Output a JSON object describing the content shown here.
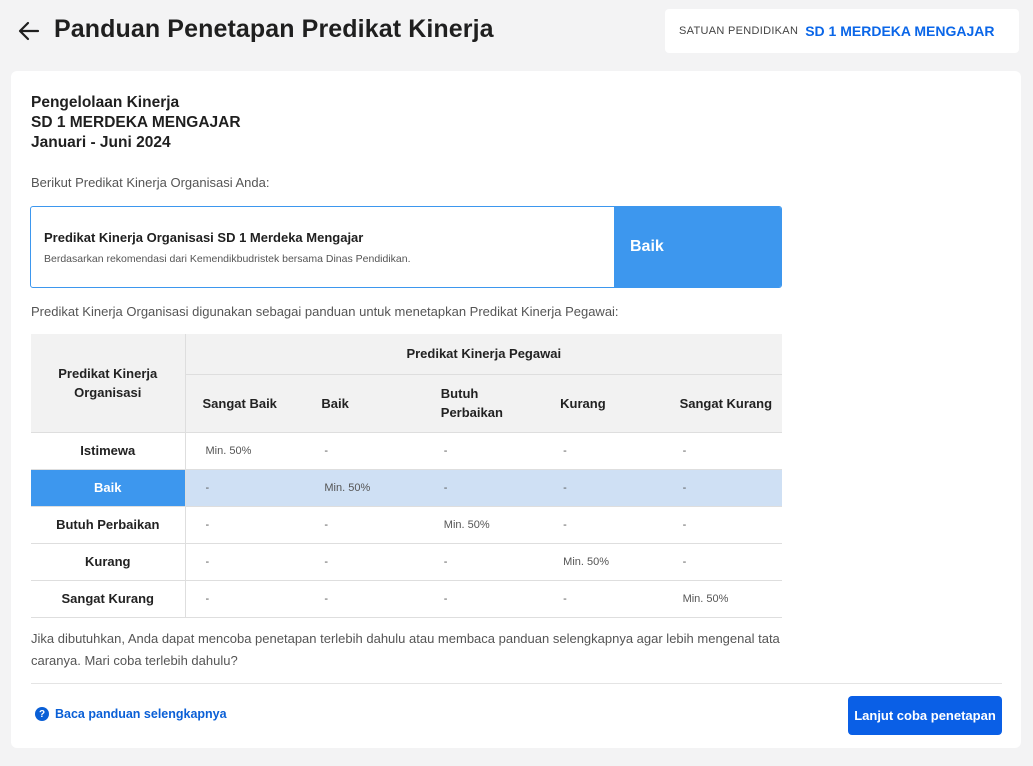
{
  "header": {
    "title": "Panduan Penetapan Predikat Kinerja",
    "school_label": "SATUAN PENDIDIKAN",
    "school_name": "SD 1 MERDEKA MENGAJAR"
  },
  "card": {
    "heading_line1": "Pengelolaan Kinerja",
    "heading_line2": "SD 1 MERDEKA MENGAJAR",
    "heading_line3": "Januari - Juni 2024",
    "intro": "Berikut Predikat Kinerja Organisasi Anda:",
    "predicate_box": {
      "title": "Predikat Kinerja Organisasi SD 1 Merdeka Mengajar",
      "subtitle": "Berdasarkan rekomendasi dari Kemendikbudristek bersama Dinas Pendidikan.",
      "result": "Baik"
    },
    "guide_text": "Predikat Kinerja Organisasi digunakan sebagai panduan untuk menetapkan Predikat Kinerja Pegawai:",
    "table": {
      "row_header": "Predikat Kinerja Organisasi",
      "group_header": "Predikat Kinerja Pegawai",
      "columns": [
        "Sangat Baik",
        "Baik",
        "Butuh Perbaikan",
        "Kurang",
        "Sangat Kurang"
      ],
      "rows": [
        {
          "label": "Istimewa",
          "cells": [
            "Min. 50%",
            "-",
            "-",
            "-",
            "-"
          ]
        },
        {
          "label": "Baik",
          "cells": [
            "-",
            "Min. 50%",
            "-",
            "-",
            "-"
          ]
        },
        {
          "label": "Butuh Perbaikan",
          "cells": [
            "-",
            "-",
            "Min. 50%",
            "-",
            "-"
          ]
        },
        {
          "label": "Kurang",
          "cells": [
            "-",
            "-",
            "-",
            "Min. 50%",
            "-"
          ]
        },
        {
          "label": "Sangat Kurang",
          "cells": [
            "-",
            "-",
            "-",
            "-",
            "Min. 50%"
          ]
        }
      ]
    },
    "note": "Jika dibutuhkan, Anda dapat mencoba penetapan terlebih dahulu atau membaca panduan selengkapnya agar lebih mengenal tata caranya. Mari coba terlebih dahulu?",
    "help_link": "Baca panduan selengkapnya",
    "cta": "Lanjut coba penetapan"
  },
  "colors": {
    "accent": "#3d97ee",
    "primary_button": "#0a5fe6",
    "link": "#0a5fd6",
    "highlight_row": "#cfe0f4"
  },
  "icons": {
    "back": "arrow-left-icon",
    "help": "question-circle-icon"
  }
}
